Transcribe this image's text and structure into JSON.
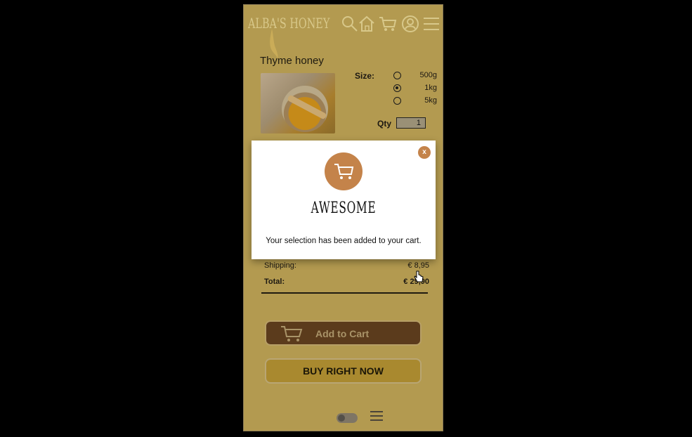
{
  "header": {
    "logo": "ALBA'S HONEY",
    "icons": [
      "search-icon",
      "home-icon",
      "cart-icon",
      "user-icon",
      "menu-icon"
    ]
  },
  "product": {
    "title": "Thyme honey",
    "size_label": "Size:",
    "sizes": [
      {
        "label": "500g",
        "selected": false
      },
      {
        "label": "1kg",
        "selected": true
      },
      {
        "label": "5kg",
        "selected": false
      }
    ],
    "qty_label": "Qty",
    "qty_value": "1"
  },
  "summary": {
    "shipping_label": "Shipping:",
    "shipping_value": "€ 8,95",
    "total_label": "Total:",
    "total_value": "€ 29,90"
  },
  "buttons": {
    "add_to_cart": "Add to Cart",
    "buy_now": "BUY RIGHT NOW"
  },
  "modal": {
    "close": "x",
    "title": "AWESOME",
    "message": "Your selection has been added to your cart."
  },
  "colors": {
    "page_bg": "#b39a50",
    "accent": "#c4834a",
    "cart_button": "#5b3b1c",
    "buy_button": "#a9892f"
  }
}
